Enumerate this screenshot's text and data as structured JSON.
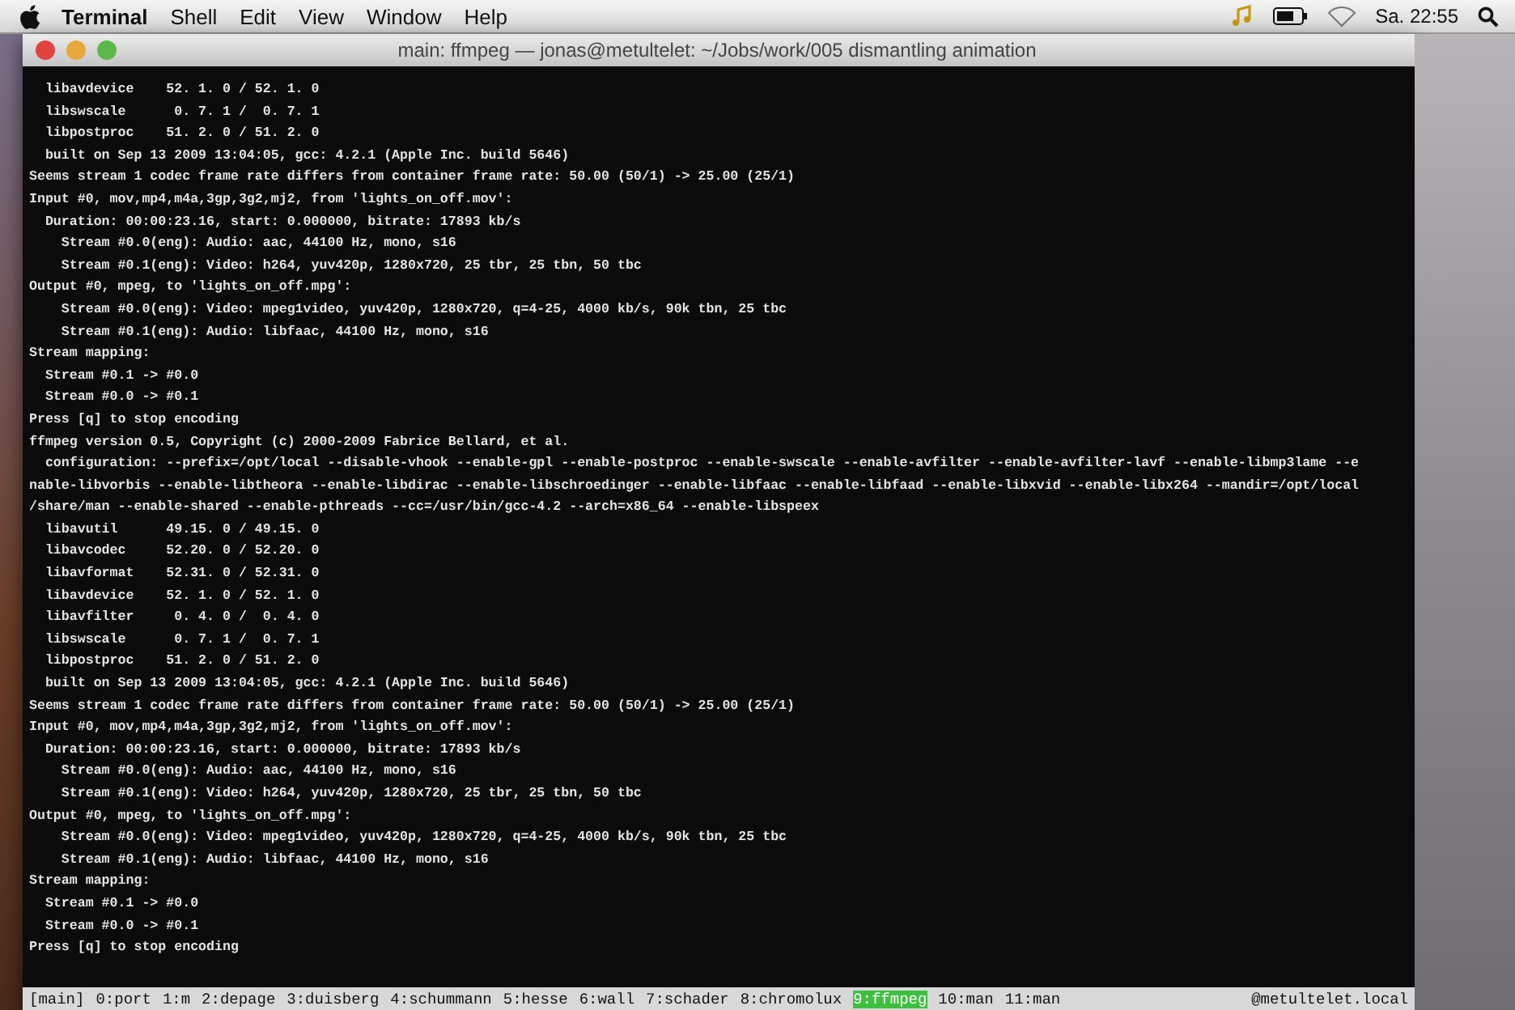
{
  "menu_bar": {
    "items": [
      {
        "label": "Terminal",
        "selected": true
      },
      {
        "label": "Shell",
        "selected": false
      },
      {
        "label": "Edit",
        "selected": false
      },
      {
        "label": "View",
        "selected": false
      },
      {
        "label": "Window",
        "selected": false
      },
      {
        "label": "Help",
        "selected": false
      }
    ],
    "clock": "Sa. 22:55"
  },
  "window": {
    "title": "main: ffmpeg — jonas@metultelet: ~/Jobs/work/005 dismantling animation"
  },
  "terminal": {
    "lines": [
      "  libavdevice    52. 1. 0 / 52. 1. 0",
      "  libswscale      0. 7. 1 /  0. 7. 1",
      "  libpostproc    51. 2. 0 / 51. 2. 0",
      "  built on Sep 13 2009 13:04:05, gcc: 4.2.1 (Apple Inc. build 5646)",
      "Seems stream 1 codec frame rate differs from container frame rate: 50.00 (50/1) -> 25.00 (25/1)",
      "Input #0, mov,mp4,m4a,3gp,3g2,mj2, from 'lights_on_off.mov':",
      "  Duration: 00:00:23.16, start: 0.000000, bitrate: 17893 kb/s",
      "    Stream #0.0(eng): Audio: aac, 44100 Hz, mono, s16",
      "    Stream #0.1(eng): Video: h264, yuv420p, 1280x720, 25 tbr, 25 tbn, 50 tbc",
      "Output #0, mpeg, to 'lights_on_off.mpg':",
      "    Stream #0.0(eng): Video: mpeg1video, yuv420p, 1280x720, q=4-25, 4000 kb/s, 90k tbn, 25 tbc",
      "    Stream #0.1(eng): Audio: libfaac, 44100 Hz, mono, s16",
      "Stream mapping:",
      "  Stream #0.1 -> #0.0",
      "  Stream #0.0 -> #0.1",
      "Press [q] to stop encoding",
      "ffmpeg version 0.5, Copyright (c) 2000-2009 Fabrice Bellard, et al.",
      "  configuration: --prefix=/opt/local --disable-vhook --enable-gpl --enable-postproc --enable-swscale --enable-avfilter --enable-avfilter-lavf --enable-libmp3lame --e",
      "nable-libvorbis --enable-libtheora --enable-libdirac --enable-libschroedinger --enable-libfaac --enable-libfaad --enable-libxvid --enable-libx264 --mandir=/opt/local",
      "/share/man --enable-shared --enable-pthreads --cc=/usr/bin/gcc-4.2 --arch=x86_64 --enable-libspeex",
      "  libavutil      49.15. 0 / 49.15. 0",
      "  libavcodec     52.20. 0 / 52.20. 0",
      "  libavformat    52.31. 0 / 52.31. 0",
      "  libavdevice    52. 1. 0 / 52. 1. 0",
      "  libavfilter     0. 4. 0 /  0. 4. 0",
      "  libswscale      0. 7. 1 /  0. 7. 1",
      "  libpostproc    51. 2. 0 / 51. 2. 0",
      "  built on Sep 13 2009 13:04:05, gcc: 4.2.1 (Apple Inc. build 5646)",
      "Seems stream 1 codec frame rate differs from container frame rate: 50.00 (50/1) -> 25.00 (25/1)",
      "Input #0, mov,mp4,m4a,3gp,3g2,mj2, from 'lights_on_off.mov':",
      "  Duration: 00:00:23.16, start: 0.000000, bitrate: 17893 kb/s",
      "    Stream #0.0(eng): Audio: aac, 44100 Hz, mono, s16",
      "    Stream #0.1(eng): Video: h264, yuv420p, 1280x720, 25 tbr, 25 tbn, 50 tbc",
      "Output #0, mpeg, to 'lights_on_off.mpg':",
      "    Stream #0.0(eng): Video: mpeg1video, yuv420p, 1280x720, q=4-25, 4000 kb/s, 90k tbn, 25 tbc",
      "    Stream #0.1(eng): Audio: libfaac, 44100 Hz, mono, s16",
      "Stream mapping:",
      "  Stream #0.1 -> #0.0",
      "  Stream #0.0 -> #0.1",
      "Press [q] to stop encoding"
    ]
  },
  "status_bar": {
    "session": "[main]",
    "windows": [
      {
        "label": "0:port",
        "selected": false
      },
      {
        "label": "1:m",
        "selected": false
      },
      {
        "label": "2:depage",
        "selected": false
      },
      {
        "label": "3:duisberg",
        "selected": false
      },
      {
        "label": "4:schummann",
        "selected": false
      },
      {
        "label": "5:hesse",
        "selected": false
      },
      {
        "label": "6:wall",
        "selected": false
      },
      {
        "label": "7:schader",
        "selected": false
      },
      {
        "label": "8:chromolux",
        "selected": false
      },
      {
        "label": "9:ffmpeg",
        "selected": true
      },
      {
        "label": "10:man",
        "selected": false
      },
      {
        "label": "11:man",
        "selected": false
      }
    ],
    "host": "@metultelet.local"
  }
}
